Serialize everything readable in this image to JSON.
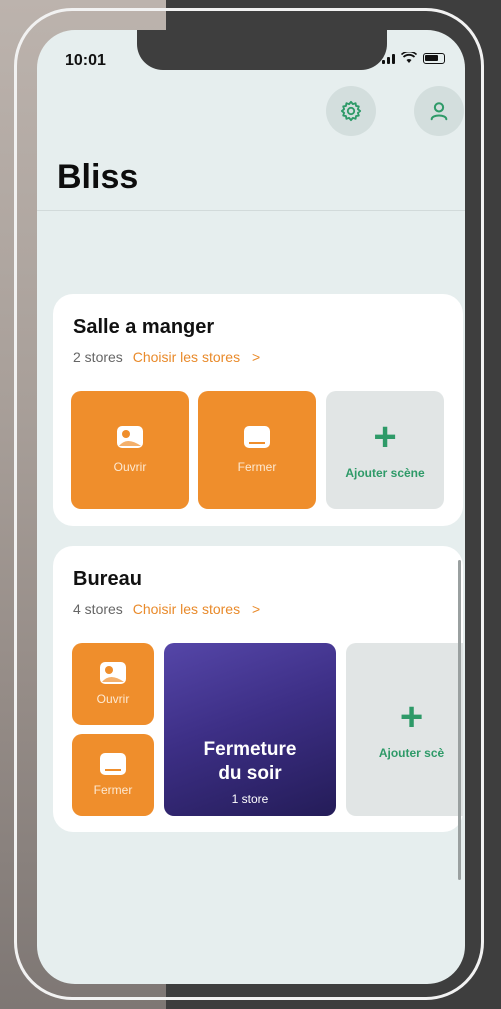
{
  "status_bar": {
    "time": "10:01"
  },
  "header": {
    "title": "Bliss"
  },
  "rooms": [
    {
      "name": "Salle a manger",
      "count": "2 stores",
      "choose_link": "Choisir les stores",
      "chevron": ">",
      "tiles": [
        {
          "label": "Ouvrir",
          "icon": "sun-window-icon"
        },
        {
          "label": "Fermer",
          "icon": "closed-blind-icon"
        }
      ],
      "add_label": "Ajouter scène"
    },
    {
      "name": "Bureau",
      "count": "4 stores",
      "choose_link": "Choisir les stores",
      "chevron": ">",
      "tiles": [
        {
          "label": "Ouvrir",
          "icon": "sun-window-icon"
        },
        {
          "label": "Fermer",
          "icon": "closed-blind-icon"
        }
      ],
      "scene": {
        "name_line1": "Fermeture",
        "name_line2": "du soir",
        "count": "1 store"
      },
      "add_label": "Ajouter scè"
    }
  ],
  "colors": {
    "accent_orange": "#ef8e2c",
    "accent_green": "#2e9a68",
    "link_orange": "#e98a2a"
  }
}
